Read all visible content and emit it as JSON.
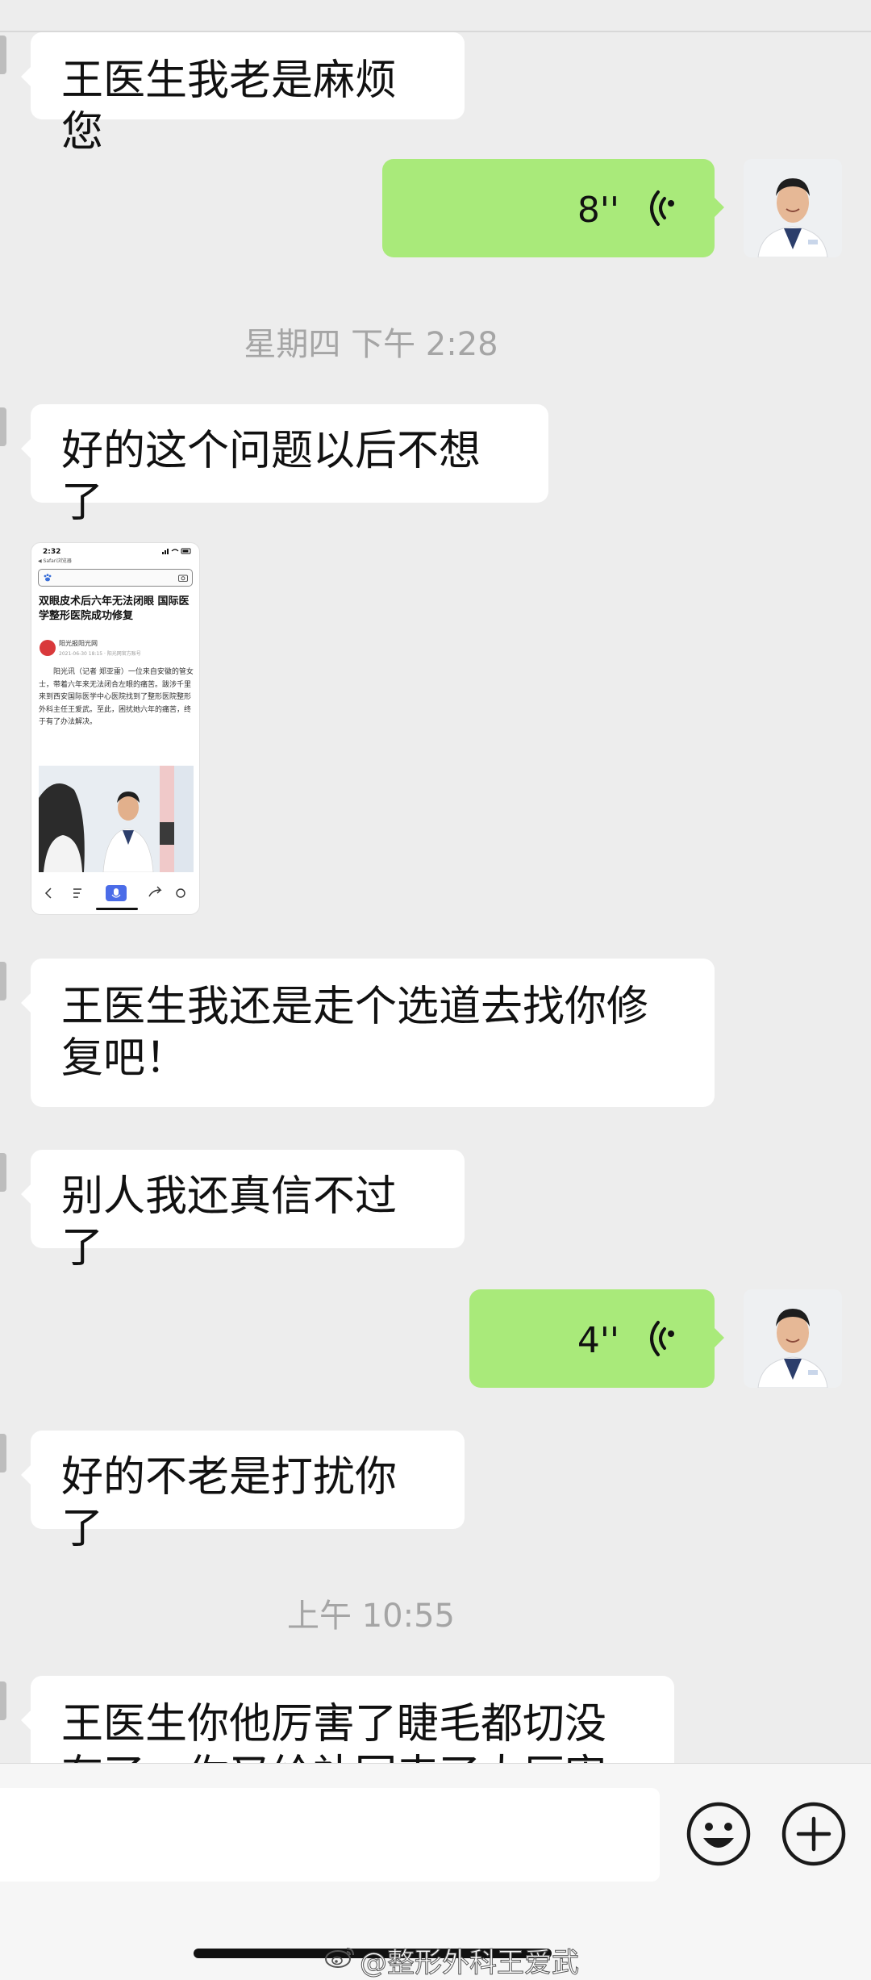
{
  "messages": [
    {
      "id": "m1",
      "direction": "in",
      "text": "王医生我老是麻烦您"
    },
    {
      "id": "m2",
      "direction": "out",
      "type": "voice",
      "duration": "8''"
    },
    {
      "id": "t1",
      "type": "timestamp",
      "text": "星期四 下午 2:28"
    },
    {
      "id": "m3",
      "direction": "in",
      "text": "好的这个问题以后不想了"
    },
    {
      "id": "m4",
      "direction": "in",
      "type": "image",
      "article": {
        "status_time": "2:32",
        "browser_label": "◀ Safari浏览器",
        "title": "双眼皮术后六年无法闭眼 国际医学整形医院成功修复",
        "source_name": "阳光报阳光网",
        "source_meta": "2021-06-30 18:15  · 阳光网官方账号",
        "body": "阳光讯（记者 郑亚雷）一位来自安徽的管女士，带着六年来无法闭合左眼的痛苦。跋涉千里来到西安国际医学中心医院找到了整形医院整形外科主任王爱武。至此，困扰她六年的痛苦，终于有了办法解决。"
      }
    },
    {
      "id": "m5",
      "direction": "in",
      "text": "王医生我还是走个选道去找你修复吧！"
    },
    {
      "id": "m6",
      "direction": "in",
      "text": "别人我还真信不过了"
    },
    {
      "id": "m7",
      "direction": "out",
      "type": "voice",
      "duration": "4''"
    },
    {
      "id": "m8",
      "direction": "in",
      "text": "好的不老是打扰你了"
    },
    {
      "id": "t2",
      "type": "timestamp",
      "text": "上午 10:55"
    },
    {
      "id": "m9",
      "direction": "in",
      "text": "王医生你他厉害了睫毛都切没有了，你又给补回来了太厉害了"
    }
  ],
  "input": {
    "placeholder": "",
    "emoji_icon": "smiley-icon",
    "more_icon": "plus-icon"
  },
  "watermark": "@整形外科王爱武",
  "colors": {
    "background": "#ededed",
    "incoming_bubble": "#ffffff",
    "outgoing_bubble": "#a9ea7a",
    "timestamp": "#a5a5a5"
  }
}
